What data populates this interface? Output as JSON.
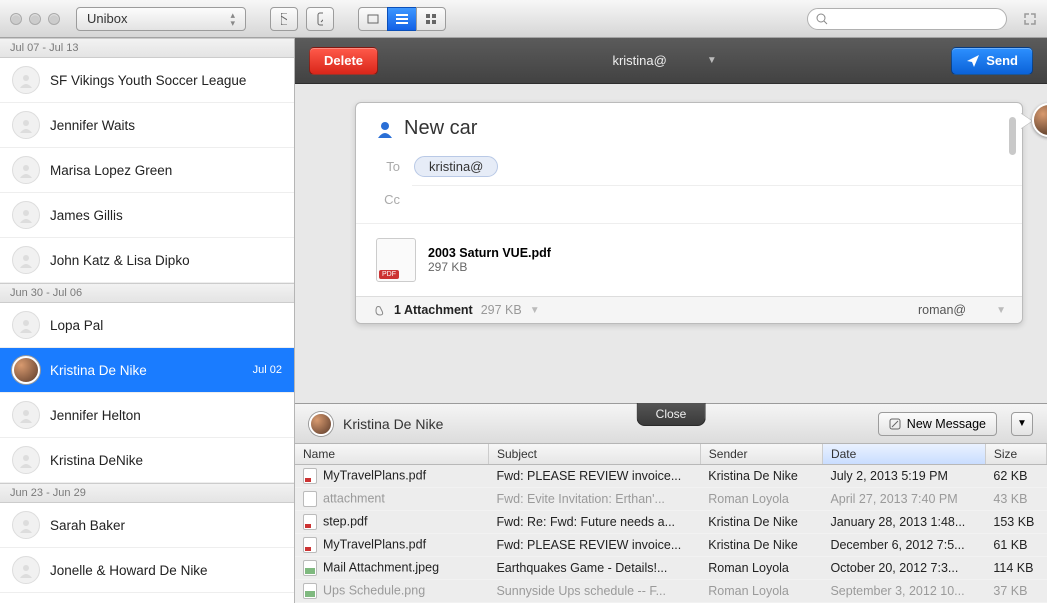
{
  "titlebar": {
    "app_name": "Unibox"
  },
  "compose": {
    "delete_label": "Delete",
    "send_label": "Send",
    "from": "kristina@",
    "subject": "New car",
    "to_label": "To",
    "cc_label": "Cc",
    "to_chip": "kristina@",
    "attachment": {
      "name": "2003 Saturn VUE.pdf",
      "size": "297 KB"
    },
    "footer": {
      "count_label": "1 Attachment",
      "size": "297 KB",
      "sender": "roman@"
    }
  },
  "sidebar": {
    "groups": [
      {
        "label": "Jul 07 - Jul 13",
        "contacts": [
          {
            "name": "SF Vikings Youth Soccer League"
          },
          {
            "name": "Jennifer Waits"
          },
          {
            "name": "Marisa Lopez Green"
          },
          {
            "name": "James Gillis"
          },
          {
            "name": "John Katz & Lisa Dipko"
          }
        ]
      },
      {
        "label": "Jun 30 - Jul 06",
        "contacts": [
          {
            "name": "Lopa Pal"
          },
          {
            "name": "Kristina De Nike",
            "selected": true,
            "date": "Jul 02"
          },
          {
            "name": "Jennifer Helton"
          },
          {
            "name": "Kristina DeNike"
          }
        ]
      },
      {
        "label": "Jun 23 - Jun 29",
        "contacts": [
          {
            "name": "Sarah Baker"
          },
          {
            "name": "Jonelle & Howard De Nike"
          }
        ]
      }
    ]
  },
  "bottom": {
    "contact": "Kristina De Nike",
    "close_label": "Close",
    "new_message_label": "New Message",
    "columns": {
      "name": "Name",
      "subject": "Subject",
      "sender": "Sender",
      "date": "Date",
      "size": "Size"
    },
    "rows": [
      {
        "icon": "pdf",
        "name": "MyTravelPlans.pdf",
        "subject": "Fwd: PLEASE REVIEW invoice...",
        "sender": "Kristina De Nike",
        "date": "July 2, 2013 5:19 PM",
        "size": "62 KB"
      },
      {
        "icon": "",
        "name": "attachment",
        "subject": "Fwd: Evite Invitation: Erthan'...",
        "sender": "Roman Loyola",
        "date": "April 27, 2013 7:40 PM",
        "size": "43 KB",
        "dim": true
      },
      {
        "icon": "pdf",
        "name": "step.pdf",
        "subject": "Fwd: Re: Fwd: Future needs a...",
        "sender": "Kristina De Nike",
        "date": "January 28, 2013 1:48...",
        "size": "153 KB"
      },
      {
        "icon": "pdf",
        "name": "MyTravelPlans.pdf",
        "subject": "Fwd: PLEASE REVIEW invoice...",
        "sender": "Kristina De Nike",
        "date": "December 6, 2012 7:5...",
        "size": "61 KB"
      },
      {
        "icon": "img",
        "name": "Mail Attachment.jpeg",
        "subject": "Earthquakes Game - Details!...",
        "sender": "Roman Loyola",
        "date": "October 20, 2012 7:3...",
        "size": "114 KB"
      },
      {
        "icon": "img",
        "name": "Ups Schedule.png",
        "subject": "Sunnyside Ups schedule -- F...",
        "sender": "Roman Loyola",
        "date": "September 3, 2012 10...",
        "size": "37 KB",
        "dim": true
      }
    ]
  }
}
